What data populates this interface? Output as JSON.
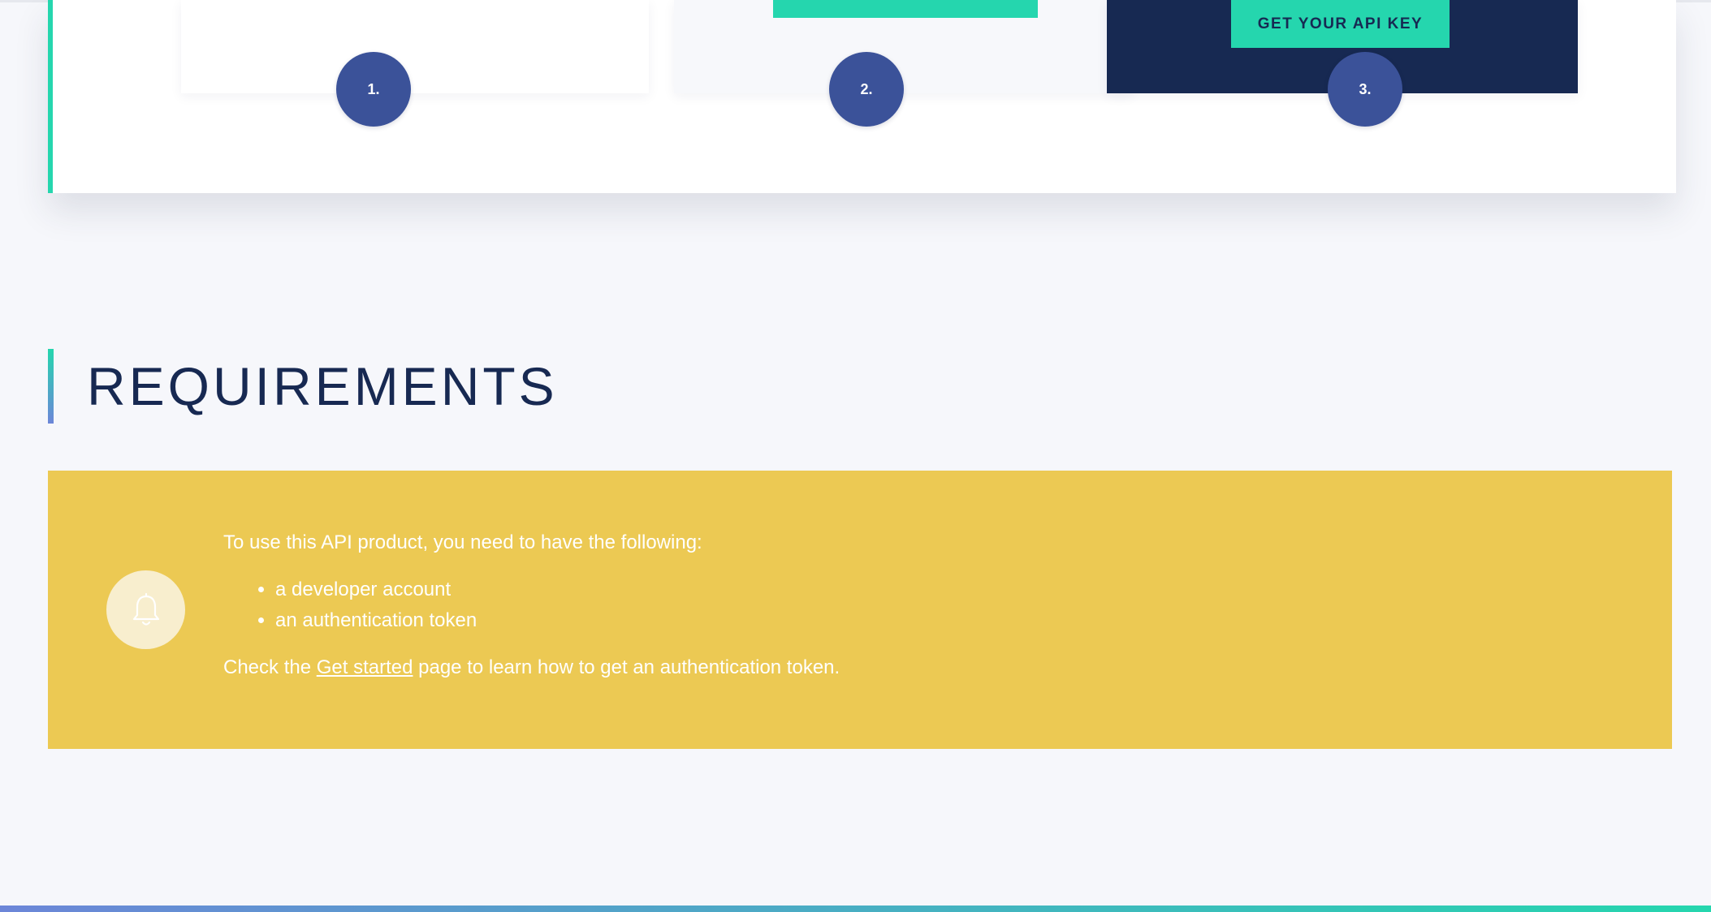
{
  "steps": {
    "items": [
      {
        "number": "1."
      },
      {
        "number": "2."
      },
      {
        "number": "3."
      }
    ],
    "api_key_button_label": "GET YOUR API KEY"
  },
  "requirements": {
    "title": "REQUIREMENTS",
    "notice": {
      "icon": "bell-icon",
      "intro": "To use this API product, you need to have the following:",
      "items": [
        "a developer account",
        "an authentication token"
      ],
      "footer_before_link": "Check the ",
      "footer_link": "Get started",
      "footer_after_link": " page to learn how to get an authentication token."
    }
  },
  "colors": {
    "accent": "#25d6ae",
    "navy": "#172952",
    "step_badge": "#3b5299",
    "notice_background": "#ecc953",
    "page_background": "#f6f7fb"
  }
}
